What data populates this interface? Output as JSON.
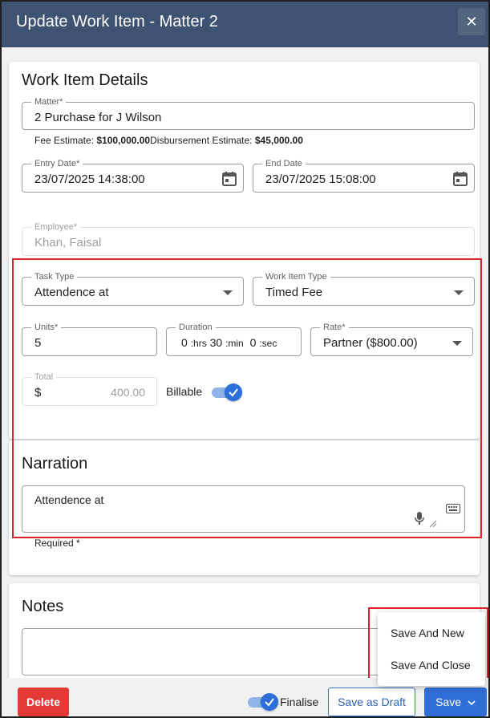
{
  "dialog": {
    "title": "Update Work Item - Matter 2",
    "close_icon": "close-icon"
  },
  "details": {
    "heading": "Work Item Details",
    "matter": {
      "label": "Matter*",
      "value": "2 Purchase for J Wilson"
    },
    "fee_estimate_label": "Fee Estimate:",
    "fee_estimate_value": "$100,000.00",
    "disbursement_estimate_label": "Disbursement Estimate:",
    "disbursement_estimate_value": "$45,000.00",
    "entry_date": {
      "label": "Entry Date*",
      "value": "23/07/2025 14:38:00"
    },
    "end_date": {
      "label": "End Date",
      "value": "23/07/2025 15:08:00"
    },
    "employee": {
      "label": "Employee*",
      "value": "Khan, Faisal"
    },
    "task_type": {
      "label": "Task Type",
      "value": "Attendence at"
    },
    "work_item_type": {
      "label": "Work Item Type",
      "value": "Timed Fee"
    },
    "units": {
      "label": "Units*",
      "value": "5"
    },
    "duration": {
      "label": "Duration",
      "hrs": "0",
      "hrs_suffix": ":hrs",
      "min": "30",
      "min_suffix": ":min",
      "sec": "0",
      "sec_suffix": ":sec"
    },
    "rate": {
      "label": "Rate*",
      "value": "Partner ($800.00)"
    },
    "total": {
      "label": "Total",
      "currency": "$",
      "value": "400.00"
    },
    "billable_label": "Billable",
    "billable_on": true
  },
  "narration": {
    "heading": "Narration",
    "value": "Attendence at",
    "required_text": "Required *"
  },
  "notes": {
    "heading": "Notes"
  },
  "footer": {
    "delete_label": "Delete",
    "finalise_label": "Finalise",
    "finalise_on": true,
    "save_draft_label": "Save as Draft",
    "save_label": "Save"
  },
  "save_menu": {
    "items": [
      "Save And New",
      "Save And Close"
    ]
  },
  "colors": {
    "header": "#3d5371",
    "primary": "#2f6fd7",
    "danger": "#e53935",
    "highlight": "#d9262c"
  }
}
